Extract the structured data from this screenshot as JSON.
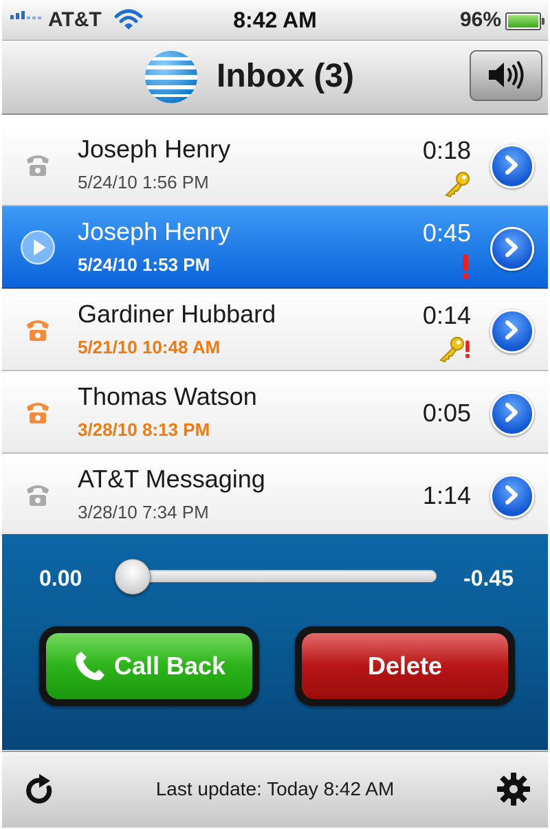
{
  "status_bar": {
    "carrier": "AT&T",
    "time": "8:42 AM",
    "battery_percent": "96%",
    "battery_level": 0.96,
    "icons": [
      "signal-bars-icon",
      "wifi-icon",
      "battery-icon"
    ]
  },
  "nav": {
    "title": "Inbox (3)",
    "logo": "att-globe-logo",
    "speaker_icon": "speaker-icon"
  },
  "messages": [
    {
      "name": "Joseph Henry",
      "date": "5/24/10 1:56 PM",
      "duration": "0:18",
      "unheard": false,
      "selected": false,
      "flags": [
        "key-icon"
      ]
    },
    {
      "name": "Joseph Henry",
      "date": "5/24/10 1:53 PM",
      "duration": "0:45",
      "unheard": false,
      "selected": true,
      "flags": [
        "urgent-icon"
      ]
    },
    {
      "name": "Gardiner Hubbard",
      "date": "5/21/10 10:48 AM",
      "duration": "0:14",
      "unheard": true,
      "selected": false,
      "flags": [
        "key-icon",
        "urgent-icon"
      ]
    },
    {
      "name": "Thomas Watson",
      "date": "3/28/10 8:13 PM",
      "duration": "0:05",
      "unheard": true,
      "selected": false,
      "flags": []
    },
    {
      "name": "AT&T Messaging",
      "date": "3/28/10 7:34 PM",
      "duration": "1:14",
      "unheard": false,
      "selected": false,
      "flags": []
    }
  ],
  "player": {
    "elapsed": "0.00",
    "remaining": "-0.45",
    "progress": 0.0,
    "call_back_label": "Call Back",
    "delete_label": "Delete"
  },
  "toolbar": {
    "last_update": "Last update: Today 8:42 AM"
  },
  "colors": {
    "selected_row": "#0a63dc",
    "unheard_text": "#f07a12",
    "player_bg": "#0a5d97",
    "call_button": "#2cb31a",
    "delete_button": "#b81515"
  }
}
